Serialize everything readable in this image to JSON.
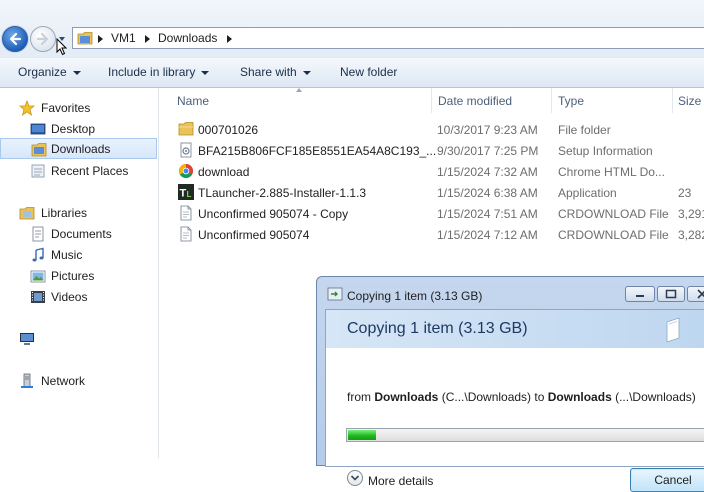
{
  "address_bar": {
    "crumbs": [
      "VM1",
      "Downloads"
    ]
  },
  "toolbar": {
    "organize": "Organize",
    "include_in_library": "Include in library",
    "share_with": "Share with",
    "new_folder": "New folder"
  },
  "sidebar": {
    "favorites": "Favorites",
    "desktop": "Desktop",
    "downloads": "Downloads",
    "recent_places": "Recent Places",
    "libraries": "Libraries",
    "documents": "Documents",
    "music": "Music",
    "pictures": "Pictures",
    "videos": "Videos",
    "network": "Network"
  },
  "columns": {
    "name": "Name",
    "date_modified": "Date modified",
    "type": "Type",
    "size": "Size"
  },
  "files": [
    {
      "name": "000701026",
      "date": "10/3/2017 9:23 AM",
      "type": "File folder",
      "size": "",
      "icon": "folder-icon"
    },
    {
      "name": "BFA215B806FCF185E8551EA54A8C193_...",
      "date": "9/30/2017 7:25 PM",
      "type": "Setup Information",
      "size": "",
      "icon": "setup-file-icon"
    },
    {
      "name": "download",
      "date": "1/15/2024 7:32 AM",
      "type": "Chrome HTML Do...",
      "size": "",
      "icon": "chrome-icon"
    },
    {
      "name": "TLauncher-2.885-Installer-1.1.3",
      "date": "1/15/2024 6:38 AM",
      "type": "Application",
      "size": "23",
      "icon": "tlauncher-icon"
    },
    {
      "name": "Unconfirmed 905074 - Copy",
      "date": "1/15/2024 7:51 AM",
      "type": "CRDOWNLOAD File",
      "size": "3,291",
      "icon": "document-icon"
    },
    {
      "name": "Unconfirmed 905074",
      "date": "1/15/2024 7:12 AM",
      "type": "CRDOWNLOAD File",
      "size": "3,282",
      "icon": "document-icon"
    }
  ],
  "copy_dialog": {
    "title": "Copying 1 item (3.13 GB)",
    "heading": "Copying 1 item (3.13 GB)",
    "from_prefix": "from ",
    "from_bold": "Downloads",
    "from_path": " (C...\\Downloads) to ",
    "to_bold": "Downloads",
    "to_path": " (...\\Downloads)",
    "progress_fraction": 0.08,
    "more_details": "More details",
    "cancel": "Cancel"
  },
  "colors": {
    "selection": "#d7e7fa",
    "progress": "#1bb61b",
    "accent": "#1f5fb8"
  }
}
